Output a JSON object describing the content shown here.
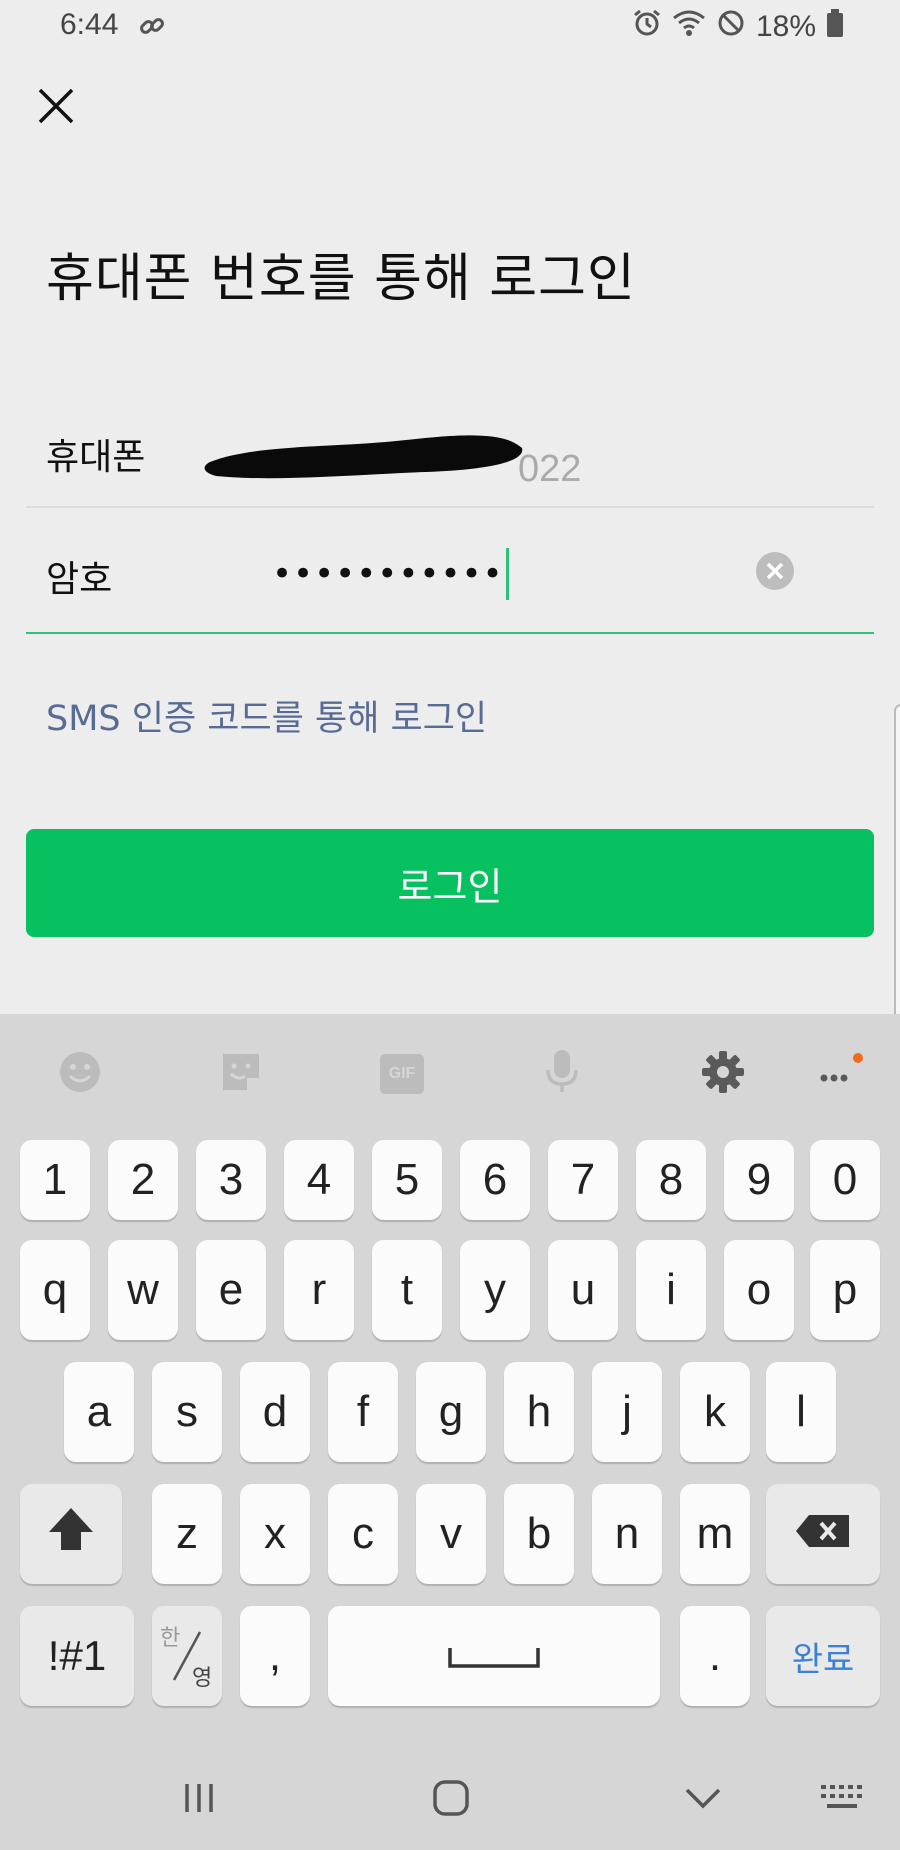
{
  "status_bar": {
    "time": "6:44",
    "battery": "18%"
  },
  "title": "휴대폰 번호를 통해 로그인",
  "phone_row": {
    "label": "휴대폰",
    "value_visible_tail": "022"
  },
  "password_row": {
    "label": "암호",
    "value_masked": "•••••••••••"
  },
  "sms_login_link": "SMS 인증 코드를 통해 로그인",
  "login_button": "로그인",
  "keyboard": {
    "toolbar": [
      "emoji-icon",
      "sticker-icon",
      "gif-icon",
      "mic-icon",
      "gear-icon",
      "more-icon"
    ],
    "gif_label": "GIF",
    "row_numbers": [
      "1",
      "2",
      "3",
      "4",
      "5",
      "6",
      "7",
      "8",
      "9",
      "0"
    ],
    "row1": [
      "q",
      "w",
      "e",
      "r",
      "t",
      "y",
      "u",
      "i",
      "o",
      "p"
    ],
    "row2": [
      "a",
      "s",
      "d",
      "f",
      "g",
      "h",
      "j",
      "k",
      "l"
    ],
    "row3": [
      "z",
      "x",
      "c",
      "v",
      "b",
      "n",
      "m"
    ],
    "symbols_key": "!#1",
    "lang_key_top": "한",
    "lang_key_bottom": "영",
    "comma_key": ",",
    "period_key": ".",
    "done_key": "완료"
  },
  "colors": {
    "accent_green": "#07c160",
    "link_blue": "#576b95",
    "done_blue": "#3b82d6"
  }
}
